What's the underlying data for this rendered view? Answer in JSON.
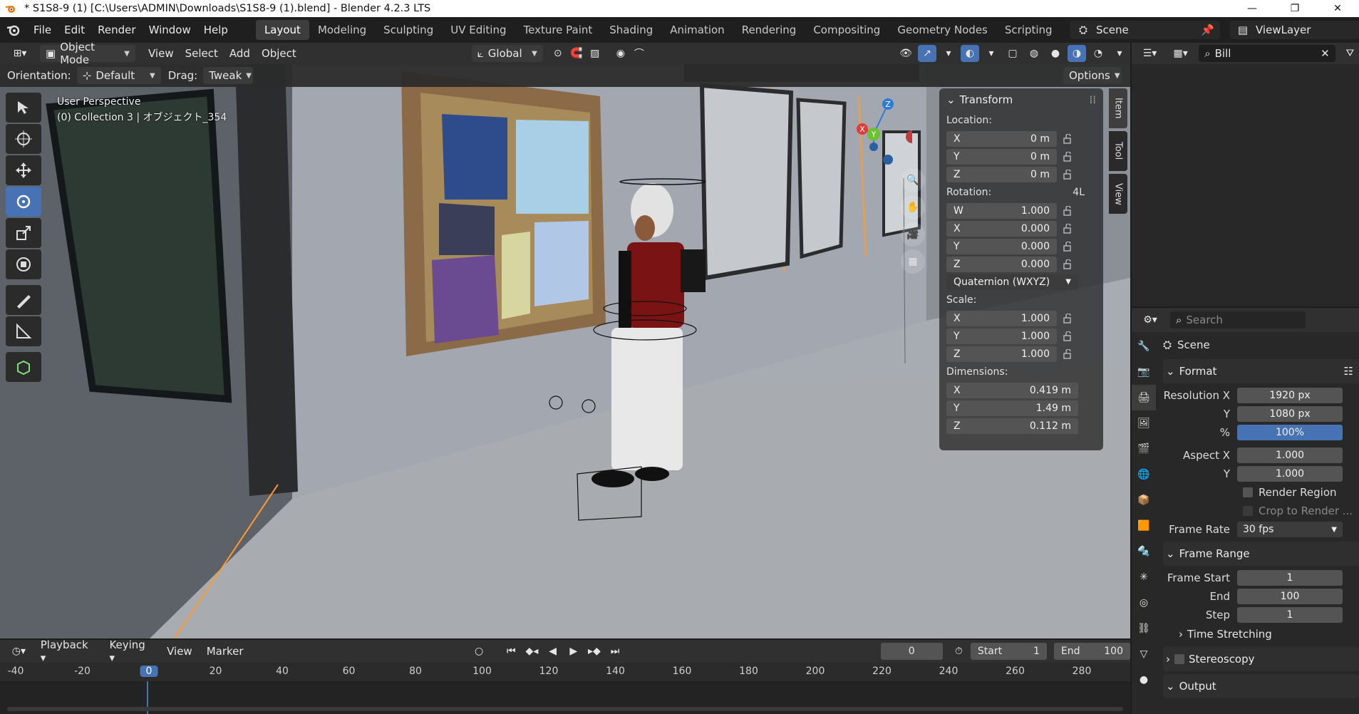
{
  "titlebar": {
    "title": "* S1S8-9 (1) [C:\\Users\\ADMIN\\Downloads\\S1S8-9 (1).blend] - Blender 4.2.3 LTS"
  },
  "menu": [
    "File",
    "Edit",
    "Render",
    "Window",
    "Help"
  ],
  "workspaces": [
    "Layout",
    "Modeling",
    "Sculpting",
    "UV Editing",
    "Texture Paint",
    "Shading",
    "Animation",
    "Rendering",
    "Compositing",
    "Geometry Nodes",
    "Scripting"
  ],
  "scene_name": "Scene",
  "view_layer": "ViewLayer",
  "viewport_header": {
    "mode": "Object Mode",
    "menus": [
      "View",
      "Select",
      "Add",
      "Object"
    ],
    "transform_orientation": "Global",
    "orientation_label": "Orientation:",
    "orientation_value": "Default",
    "drag_label": "Drag:",
    "drag_value": "Tweak",
    "options": "Options"
  },
  "viewport_info": {
    "line1": "User Perspective",
    "line2": "(0) Collection 3 | オブジェクト_354"
  },
  "transform_panel": {
    "title": "Transform",
    "location_label": "Location:",
    "location": [
      {
        "axis": "X",
        "value": "0 m"
      },
      {
        "axis": "Y",
        "value": "0 m"
      },
      {
        "axis": "Z",
        "value": "0 m"
      }
    ],
    "rotation_label": "Rotation:",
    "rotation_extra": "4L",
    "rotation": [
      {
        "axis": "W",
        "value": "1.000"
      },
      {
        "axis": "X",
        "value": "0.000"
      },
      {
        "axis": "Y",
        "value": "0.000"
      },
      {
        "axis": "Z",
        "value": "0.000"
      }
    ],
    "rotation_mode": "Quaternion (WXYZ)",
    "scale_label": "Scale:",
    "scale": [
      {
        "axis": "X",
        "value": "1.000"
      },
      {
        "axis": "Y",
        "value": "1.000"
      },
      {
        "axis": "Z",
        "value": "1.000"
      }
    ],
    "dimensions_label": "Dimensions:",
    "dimensions": [
      {
        "axis": "X",
        "value": "0.419 m"
      },
      {
        "axis": "Y",
        "value": "1.49 m"
      },
      {
        "axis": "Z",
        "value": "0.112 m"
      }
    ]
  },
  "n_tabs": [
    "Item",
    "Tool",
    "View"
  ],
  "gizmo": {
    "x": "X",
    "y": "Y",
    "z": "Z"
  },
  "outliner": {
    "search_value": "Bill"
  },
  "properties": {
    "search_placeholder": "Search",
    "context": "Scene",
    "format": {
      "title": "Format",
      "res_x_label": "Resolution X",
      "res_x": "1920 px",
      "res_y_label": "Y",
      "res_y": "1080 px",
      "pct_label": "%",
      "pct": "100%",
      "aspect_x_label": "Aspect X",
      "aspect_x": "1.000",
      "aspect_y_label": "Y",
      "aspect_y": "1.000",
      "render_region": "Render Region",
      "crop": "Crop to Render ...",
      "frame_rate_label": "Frame Rate",
      "frame_rate": "30 fps"
    },
    "frame_range": {
      "title": "Frame Range",
      "start_label": "Frame Start",
      "start": "1",
      "end_label": "End",
      "end": "100",
      "step_label": "Step",
      "step": "1"
    },
    "time_stretching": "Time Stretching",
    "stereoscopy": "Stereoscopy",
    "output": "Output"
  },
  "timeline": {
    "menus": [
      "Playback",
      "Keying",
      "View",
      "Marker"
    ],
    "current_frame": "0",
    "start_label": "Start",
    "start": "1",
    "end_label": "End",
    "end": "100",
    "ruler": [
      "-40",
      "-20",
      "0",
      "20",
      "40",
      "60",
      "80",
      "100",
      "120",
      "140",
      "160",
      "180",
      "200",
      "220",
      "240",
      "260",
      "280"
    ]
  },
  "colors": {
    "accent": "#4772b3",
    "selection_outline": "#ff9a2e"
  }
}
